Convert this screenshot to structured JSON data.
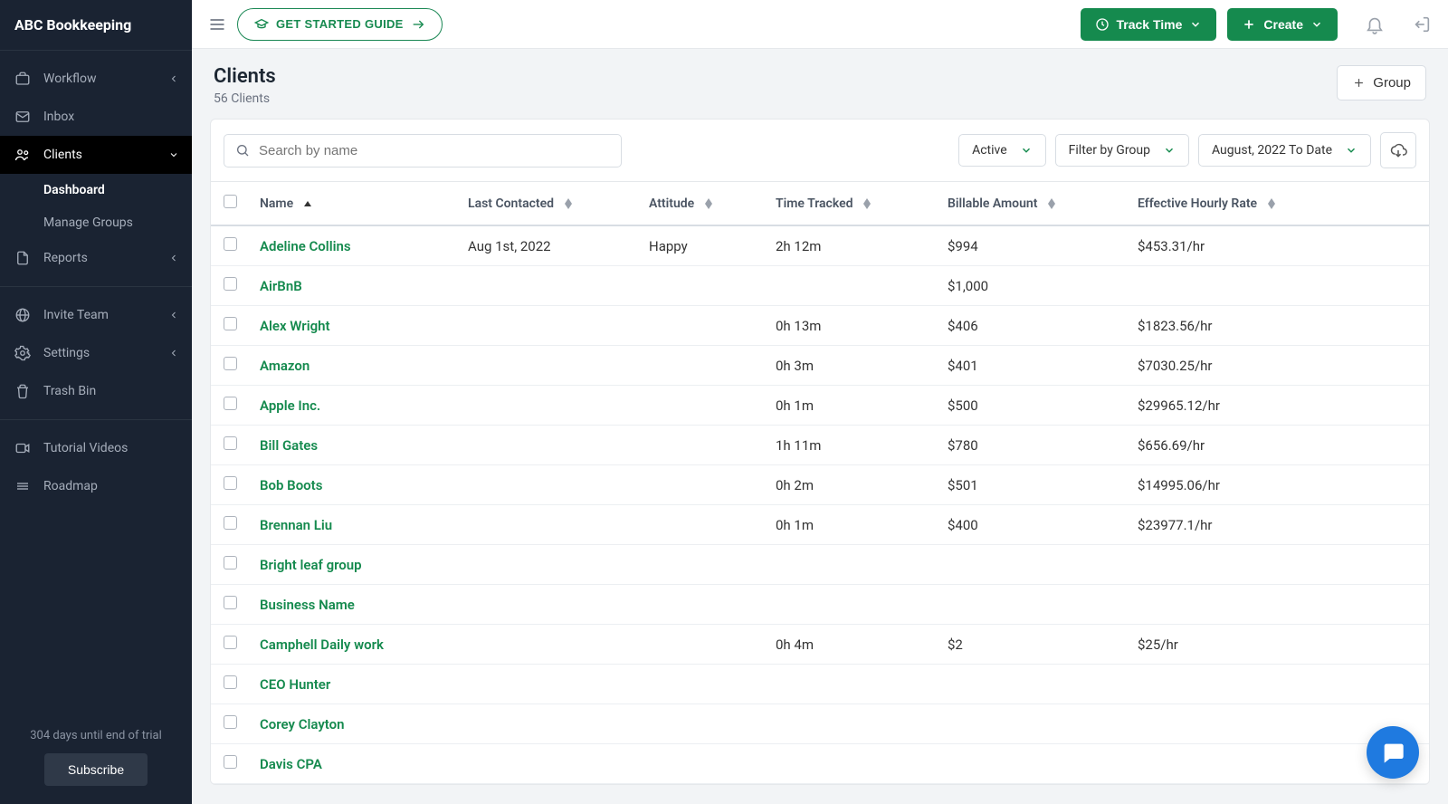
{
  "brand": "ABC Bookkeeping",
  "sidebar": {
    "items": [
      {
        "label": "Workflow",
        "icon": "briefcase",
        "expandable": true
      },
      {
        "label": "Inbox",
        "icon": "mail"
      },
      {
        "label": "Clients",
        "icon": "users",
        "expandable": true,
        "active": true,
        "subs": [
          {
            "label": "Dashboard",
            "selected": true
          },
          {
            "label": "Manage Groups"
          }
        ]
      },
      {
        "label": "Reports",
        "icon": "file",
        "expandable": true
      }
    ],
    "secondary": [
      {
        "label": "Invite Team",
        "icon": "globe",
        "expandable": true
      },
      {
        "label": "Settings",
        "icon": "gear",
        "expandable": true
      },
      {
        "label": "Trash Bin",
        "icon": "trash"
      }
    ],
    "tertiary": [
      {
        "label": "Tutorial Videos",
        "icon": "video"
      },
      {
        "label": "Roadmap",
        "icon": "map"
      }
    ],
    "trial": "304 days until end of trial",
    "subscribe": "Subscribe"
  },
  "topbar": {
    "guide": "GET STARTED GUIDE",
    "track": "Track Time",
    "create": "Create"
  },
  "page": {
    "title": "Clients",
    "subtitle": "56 Clients",
    "group_btn": "Group"
  },
  "filters": {
    "search_placeholder": "Search by name",
    "status": "Active",
    "group": "Filter by Group",
    "date": "August, 2022 To Date"
  },
  "columns": [
    "Name",
    "Last Contacted",
    "Attitude",
    "Time Tracked",
    "Billable Amount",
    "Effective Hourly Rate"
  ],
  "rows": [
    {
      "name": "Adeline Collins",
      "last": "Aug 1st, 2022",
      "att": "Happy",
      "time": "2h 12m",
      "bill": "$994",
      "rate": "$453.31/hr"
    },
    {
      "name": "AirBnB",
      "last": "",
      "att": "",
      "time": "",
      "bill": "$1,000",
      "rate": ""
    },
    {
      "name": "Alex Wright",
      "last": "",
      "att": "",
      "time": "0h 13m",
      "bill": "$406",
      "rate": "$1823.56/hr"
    },
    {
      "name": "Amazon",
      "last": "",
      "att": "",
      "time": "0h 3m",
      "bill": "$401",
      "rate": "$7030.25/hr"
    },
    {
      "name": "Apple Inc.",
      "last": "",
      "att": "",
      "time": "0h 1m",
      "bill": "$500",
      "rate": "$29965.12/hr"
    },
    {
      "name": "Bill Gates",
      "last": "",
      "att": "",
      "time": "1h 11m",
      "bill": "$780",
      "rate": "$656.69/hr"
    },
    {
      "name": "Bob Boots",
      "last": "",
      "att": "",
      "time": "0h 2m",
      "bill": "$501",
      "rate": "$14995.06/hr"
    },
    {
      "name": "Brennan Liu",
      "last": "",
      "att": "",
      "time": "0h 1m",
      "bill": "$400",
      "rate": "$23977.1/hr"
    },
    {
      "name": "Bright leaf group",
      "last": "",
      "att": "",
      "time": "",
      "bill": "",
      "rate": ""
    },
    {
      "name": "Business Name",
      "last": "",
      "att": "",
      "time": "",
      "bill": "",
      "rate": ""
    },
    {
      "name": "Camphell Daily work",
      "last": "",
      "att": "",
      "time": "0h 4m",
      "bill": "$2",
      "rate": "$25/hr"
    },
    {
      "name": "CEO Hunter",
      "last": "",
      "att": "",
      "time": "",
      "bill": "",
      "rate": ""
    },
    {
      "name": "Corey Clayton",
      "last": "",
      "att": "",
      "time": "",
      "bill": "",
      "rate": ""
    },
    {
      "name": "Davis CPA",
      "last": "",
      "att": "",
      "time": "",
      "bill": "",
      "rate": ""
    }
  ]
}
